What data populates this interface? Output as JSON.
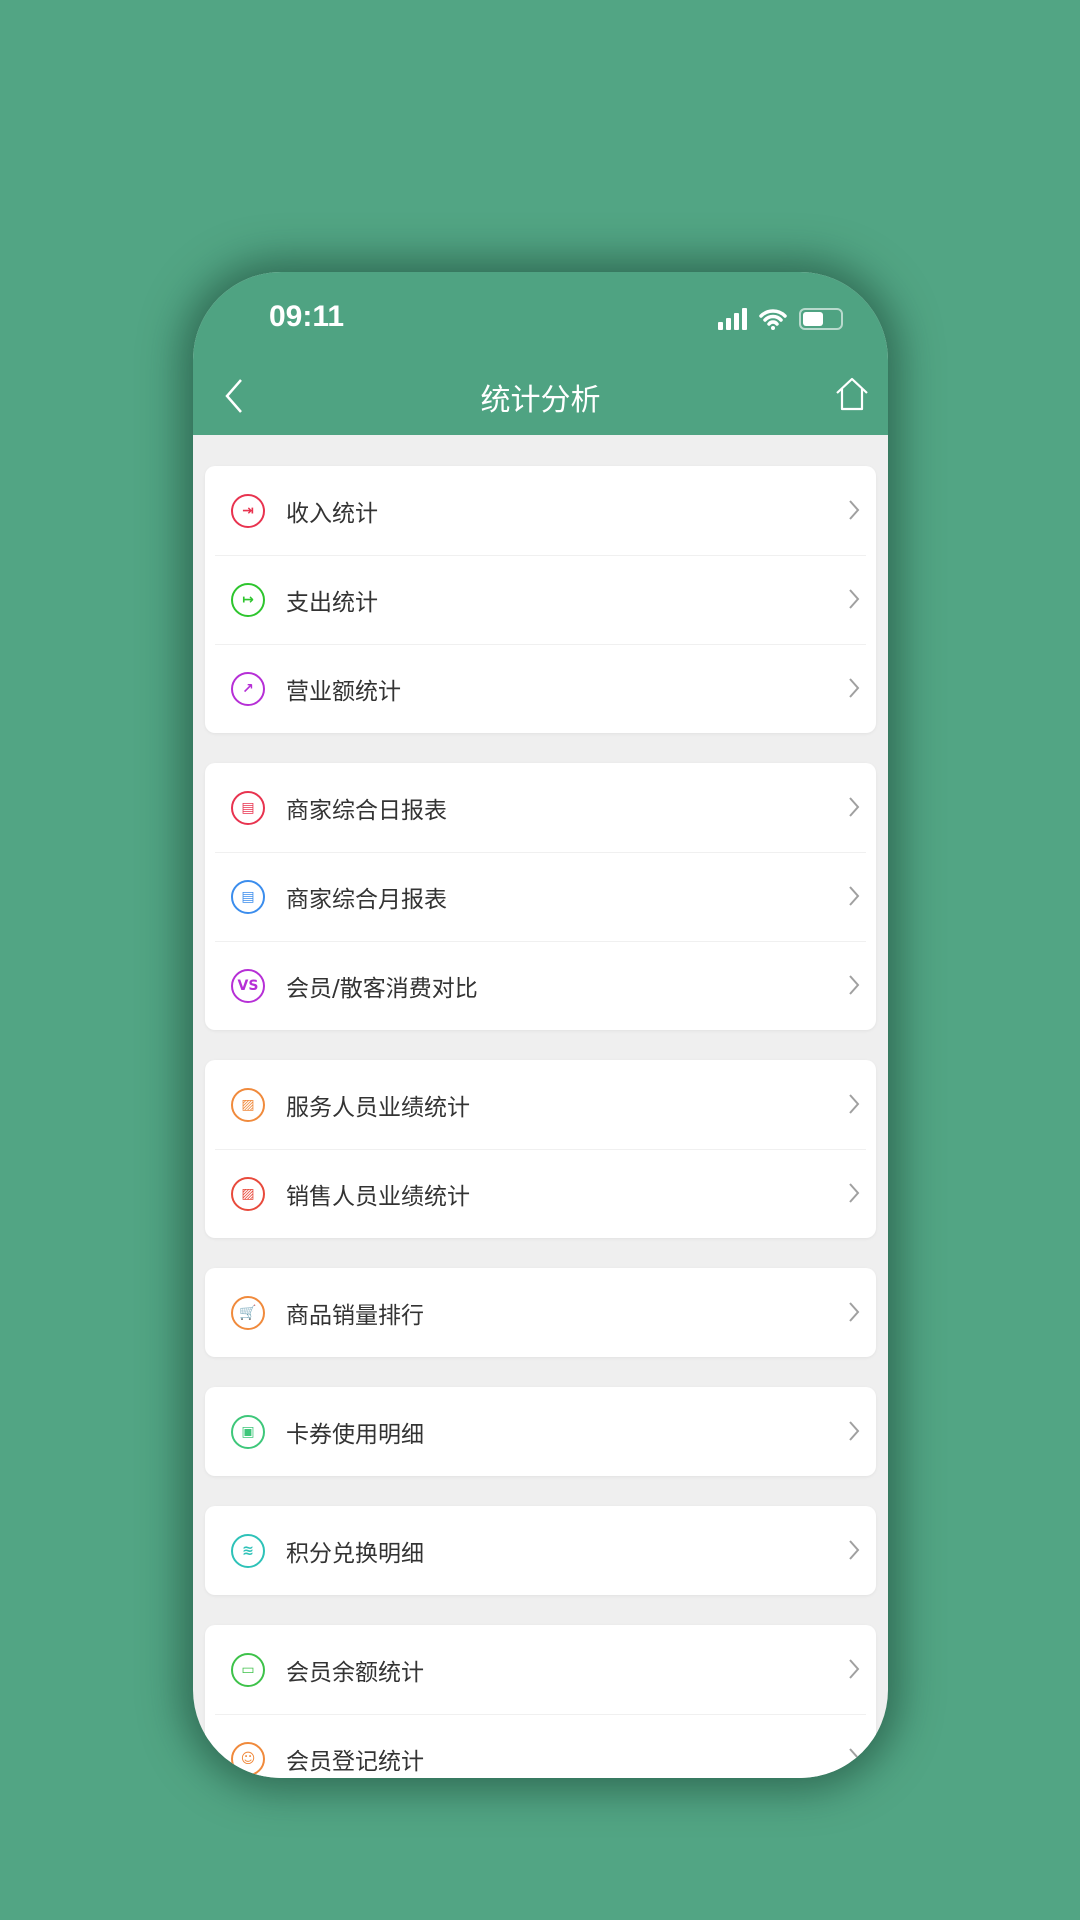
{
  "status_bar": {
    "time": "09:11"
  },
  "header": {
    "title": "统计分析"
  },
  "colors": {
    "background": "#52a584",
    "header": "#4fa382"
  },
  "groups": [
    {
      "items": [
        {
          "label": "收入统计",
          "icon": "login-icon",
          "color": "#e8334f",
          "glyph": "⇥"
        },
        {
          "label": "支出统计",
          "icon": "logout-icon",
          "color": "#2ec52e",
          "glyph": "↦"
        },
        {
          "label": "营业额统计",
          "icon": "trend-chart-icon",
          "color": "#b62fd6",
          "glyph": "↗"
        }
      ]
    },
    {
      "items": [
        {
          "label": "商家综合日报表",
          "icon": "daily-report-icon",
          "color": "#e8334f",
          "glyph": "▤"
        },
        {
          "label": "商家综合月报表",
          "icon": "monthly-report-icon",
          "color": "#3b8ded",
          "glyph": "▤"
        },
        {
          "label": "会员/散客消费对比",
          "icon": "vs-icon",
          "color": "#b62fd6",
          "glyph": "VS"
        }
      ]
    },
    {
      "items": [
        {
          "label": "服务人员业绩统计",
          "icon": "performance-chart-icon",
          "color": "#f08a3c",
          "glyph": "▨"
        },
        {
          "label": "销售人员业绩统计",
          "icon": "sales-chart-icon",
          "color": "#e84a3c",
          "glyph": "▨"
        }
      ]
    },
    {
      "items": [
        {
          "label": "商品销量排行",
          "icon": "cart-icon",
          "color": "#f08a3c",
          "glyph": "🛒"
        }
      ]
    },
    {
      "items": [
        {
          "label": "卡券使用明细",
          "icon": "coupon-icon",
          "color": "#3ec77a",
          "glyph": "▣"
        }
      ]
    },
    {
      "items": [
        {
          "label": "积分兑换明细",
          "icon": "coins-icon",
          "color": "#2ec2b8",
          "glyph": "≋"
        }
      ]
    },
    {
      "items": [
        {
          "label": "会员余额统计",
          "icon": "wallet-icon",
          "color": "#3ec24a",
          "glyph": "▭"
        },
        {
          "label": "会员登记统计",
          "icon": "user-icon",
          "color": "#f08a3c",
          "glyph": "☺"
        }
      ]
    }
  ]
}
